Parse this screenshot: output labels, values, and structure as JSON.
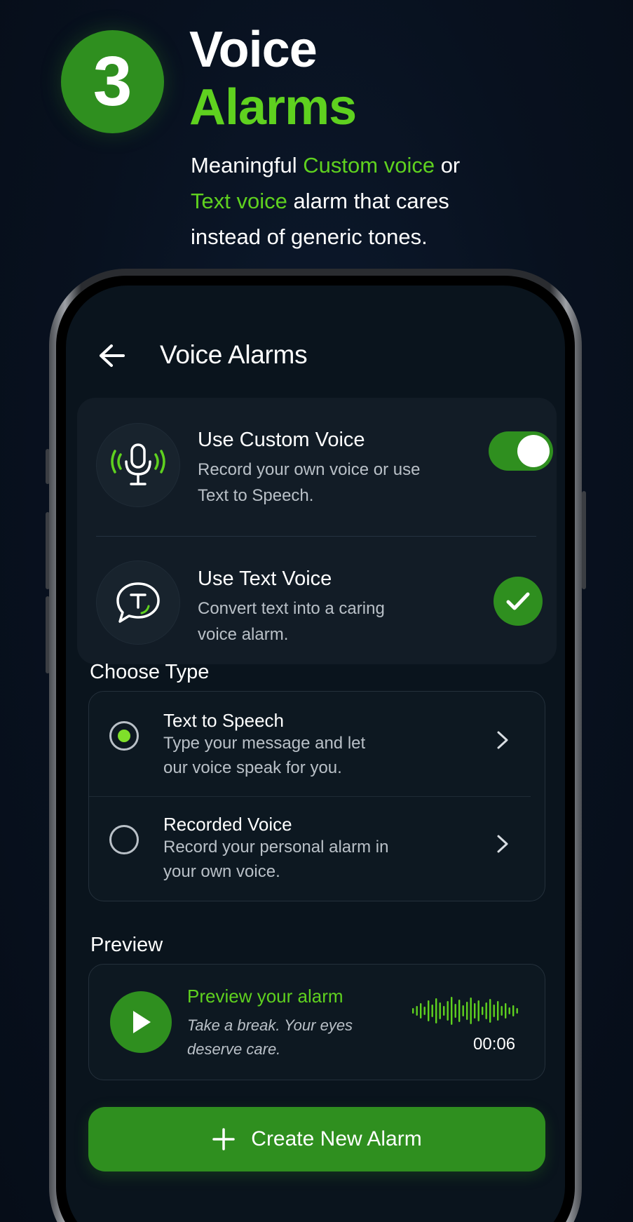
{
  "header": {
    "step_number": "3",
    "title_line1": "Voice",
    "title_line2": "Alarms",
    "tagline_parts": [
      "Meaningful ",
      "Custom voice",
      " or",
      "Text voice",
      " alarm that cares",
      "instead of generic tones."
    ]
  },
  "screen": {
    "title": "Voice Alarms",
    "back_icon": "arrow-left-icon"
  },
  "settings": {
    "custom_voice": {
      "title": "Use Custom Voice",
      "description": "Record your own voice or use Text to Speech.",
      "icon": "microphone-icon",
      "enabled": true
    },
    "text_voice": {
      "title": "Use Text Voice",
      "description": "Convert text into a caring voice alarm.",
      "icon": "speech-bubble-t-icon",
      "selected": true
    }
  },
  "choose_type": {
    "label": "Choose Type",
    "options": [
      {
        "title": "Text to Speech",
        "description": "Type your message and let our voice speak for you.",
        "selected": true
      },
      {
        "title": "Recorded Voice",
        "description": "Record your personal alarm in your own voice.",
        "selected": false
      }
    ]
  },
  "preview": {
    "label": "Preview",
    "title": "Preview your alarm",
    "quote": "Take a break. Your eyes deserve care.",
    "duration": "00:06"
  },
  "create_button": {
    "label": "Create New Alarm"
  },
  "colors": {
    "accent": "#5fd11f",
    "brand_green": "#2f8f1f",
    "background": "#08111f",
    "card": "#121c26"
  }
}
